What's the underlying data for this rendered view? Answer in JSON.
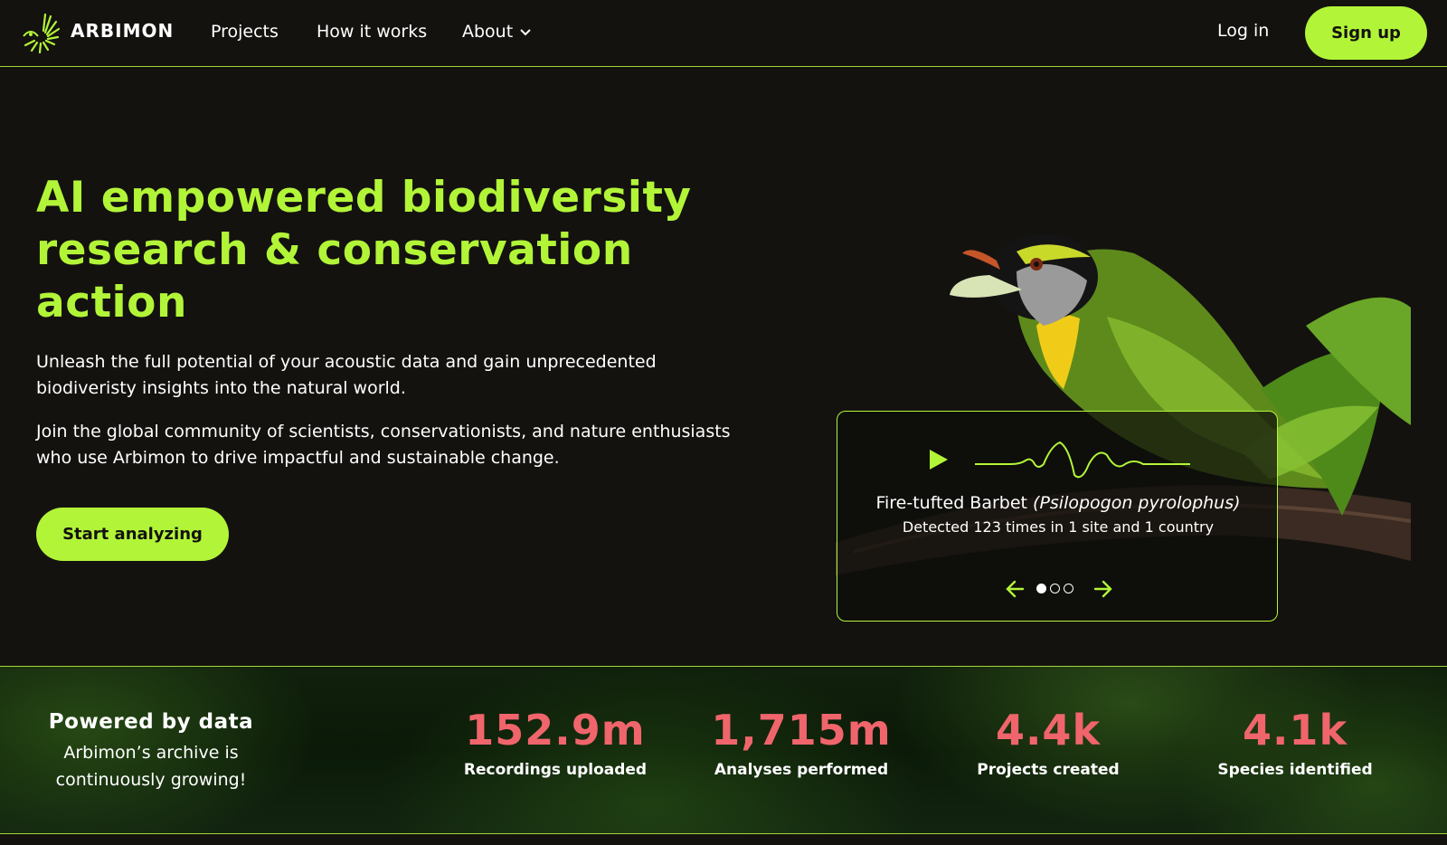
{
  "brand": {
    "name": "ARBIMON",
    "logo_icon": "sunburst-bird-logo-icon",
    "accent": "#b2f538"
  },
  "nav": {
    "projects": "Projects",
    "how_it_works": "How it works",
    "about": "About",
    "login": "Log in",
    "signup": "Sign up"
  },
  "hero": {
    "title": "AI empowered biodiversity research & conservation action",
    "paragraph1": "Unleash the full potential of your acoustic data and gain unprecedented biodiveristy insights into the natural world.",
    "paragraph2": "Join the global community of scientists, conservationists, and nature enthusiasts who use Arbimon to drive impactful and sustainable change.",
    "cta": "Start analyzing"
  },
  "species_card": {
    "common_name": "Fire-tufted Barbet",
    "scientific_name": "(Psilopogon pyrolophus)",
    "detection": "Detected 123 times in 1 site and 1 country",
    "slide_count": 3,
    "active_slide": 1
  },
  "stats": {
    "heading": "Powered by data",
    "subheading": "Arbimon’s archive is continuously growing!",
    "items": [
      {
        "value": "152.9m",
        "label": "Recordings uploaded"
      },
      {
        "value": "1,715m",
        "label": "Analyses performed"
      },
      {
        "value": "4.4k",
        "label": "Projects created"
      },
      {
        "value": "4.1k",
        "label": "Species identified"
      }
    ],
    "value_color": "#f0656c"
  }
}
